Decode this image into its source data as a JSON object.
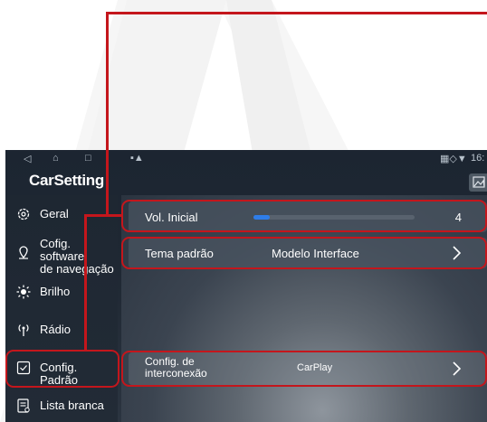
{
  "status_bar": {
    "time": "16:"
  },
  "app": {
    "title": "CarSetting"
  },
  "sidebar": {
    "items": [
      {
        "label": "Geral",
        "icon": "gear-icon"
      },
      {
        "label_line1": "Cofig. software",
        "label_line2": "de navegação",
        "icon": "navigation-pin-icon"
      },
      {
        "label": "Brilho",
        "icon": "brightness-icon"
      },
      {
        "label": "Rádio",
        "icon": "radio-icon"
      },
      {
        "label": "Config. Padrão",
        "icon": "checkbox-icon",
        "selected": true
      },
      {
        "label": "Lista branca",
        "icon": "list-icon"
      }
    ]
  },
  "settings": {
    "volume": {
      "label": "Vol. Inicial",
      "value": "4",
      "level": 0.1
    },
    "theme": {
      "label": "Tema padrão",
      "value": "Modelo Interface"
    },
    "interconnect": {
      "label_line1": "Config. de",
      "label_line2": "interconexão",
      "value": "CarPlay"
    }
  },
  "colors": {
    "highlight": "#c4161c",
    "accent": "#2e7de8"
  }
}
